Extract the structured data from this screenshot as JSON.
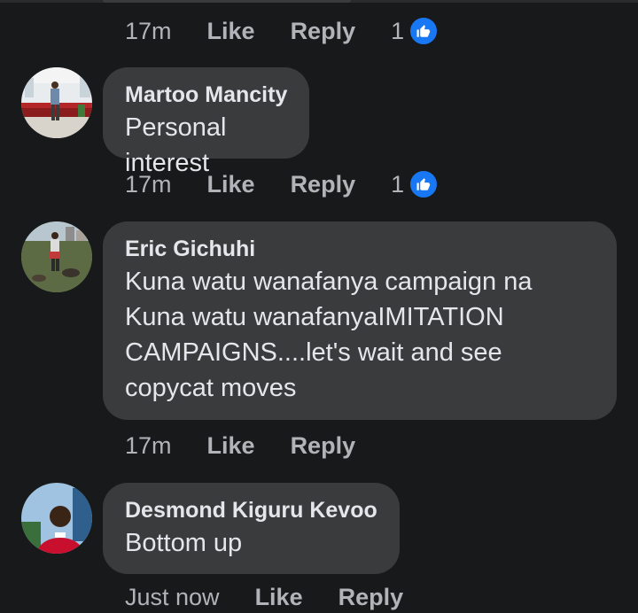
{
  "labels": {
    "like": "Like",
    "reply": "Reply"
  },
  "actions_top": {
    "time": "17m",
    "reactions": "1"
  },
  "comments": [
    {
      "author": "Martoo Mancity",
      "text": "Personal interest",
      "time": "17m",
      "reactions": "1"
    },
    {
      "author": "Eric Gichuhi",
      "text": "Kuna watu wanafanya campaign na Kuna watu wanafanyaIMITATION CAMPAIGNS....let's wait and see copycat moves",
      "time": "17m",
      "reactions": ""
    },
    {
      "author": "Desmond Kiguru Kevoo",
      "text": "Bottom up",
      "time": "Just now",
      "reactions": ""
    }
  ],
  "colors": {
    "background": "#18191a",
    "bubble": "#3a3b3c",
    "text": "#e4e6eb",
    "muted": "#b0b3b8",
    "like_blue": "#1877f2"
  },
  "icons": {
    "reaction": "thumbs-up-icon"
  }
}
